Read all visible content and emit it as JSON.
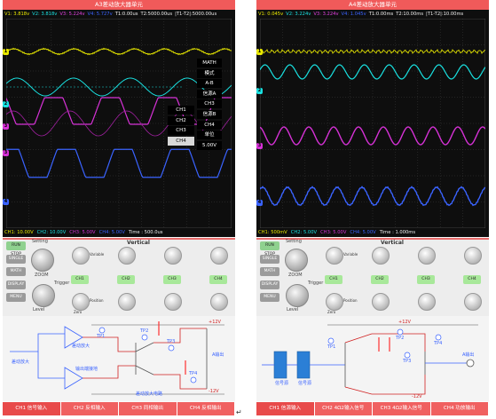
{
  "panels": {
    "a": {
      "title": "A3差动放大器单元",
      "header": {
        "v1": "V1: 3.818v",
        "v2": "V2: 3.818v",
        "v3": "V3: 5.224v",
        "v4": "V4: 5.727v",
        "t1": "T1:0.00us",
        "t2": "T2:5000.00us",
        "dt": "|T1-T2|:5000.00us"
      },
      "footer": {
        "ch1": "CH1: 10.00V",
        "ch2": "CH2: 10.00V",
        "ch3": "CH3: 5.00V",
        "ch4": "CH4: 5.00V",
        "time": "Time : 500.0us"
      },
      "menu": [
        "MATH",
        "模式",
        "A-B",
        "信源A",
        "CH3",
        "信源B",
        "CH4",
        "单位",
        "5.00V"
      ],
      "menu_left": [
        "CH1",
        "CH2",
        "CH3",
        "CH4"
      ],
      "controls": {
        "side": [
          "RUN STOP",
          "SINGLE",
          "MATH",
          "DISPLAY",
          "MENU"
        ],
        "setting": "Setting",
        "vertical": "Vertical",
        "zoom": "ZOOM",
        "trigger": "Trigger",
        "level": "Level",
        "variable": "Variable",
        "position": "Position",
        "zero": "Zero",
        "channels": [
          "CH1",
          "CH2",
          "CH3",
          "CH4"
        ]
      },
      "circuit": {
        "labels": [
          "差动放大",
          "差动放大",
          "输出端接地",
          "差动放大电路",
          "TP1",
          "TP2",
          "TP3",
          "TP4",
          "+12V",
          "-12V",
          "A输出"
        ]
      },
      "tabs": [
        "CH1 信号输入",
        "CH2 反相输入",
        "CH3 同相输出",
        "CH4 反相输出"
      ]
    },
    "b": {
      "title": "A4差动放大器单元",
      "header": {
        "v1": "V1: 0.045v",
        "v2": "V2: 3.224v",
        "v3": "V3: 3.224v",
        "v4": "V4: 1.045v",
        "t1": "T1:0.00ms",
        "t2": "T2:10.00ms",
        "dt": "|T1-T2|:10.00ms"
      },
      "footer": {
        "ch1": "CH1: 500mV",
        "ch2": "CH2: 5.00V",
        "ch3": "CH3: 5.00V",
        "ch4": "CH4: 5.00V",
        "time": "Time : 1.000ms"
      },
      "controls": {
        "side": [
          "RUN STOP",
          "SINGLE",
          "MATH",
          "DISPLAY",
          "MENU"
        ],
        "setting": "Setting",
        "vertical": "Vertical",
        "zoom": "ZOOM",
        "trigger": "Trigger",
        "level": "Level",
        "variable": "Variable",
        "position": "Position",
        "zero": "Zero",
        "channels": [
          "CH1",
          "CH2",
          "CH3",
          "CH4"
        ]
      },
      "circuit": {
        "labels": [
          "信号源",
          "信号源",
          "+12V",
          "TP1",
          "TP2",
          "TP3",
          "TP4",
          "-12V",
          "A输出"
        ]
      },
      "tabs": [
        "CH1 信源输入",
        "CH2 4Ω2输入信号",
        "CH3 4Ω2输入信号",
        "CH4 功放输出"
      ]
    }
  },
  "colors": {
    "ch1": "#e8e800",
    "ch2": "#19e0e0",
    "ch3": "#d631d6",
    "ch4": "#3a63ff",
    "ch3_header": "#e040e0",
    "accent": "#f06060"
  },
  "return_mark": "↵"
}
